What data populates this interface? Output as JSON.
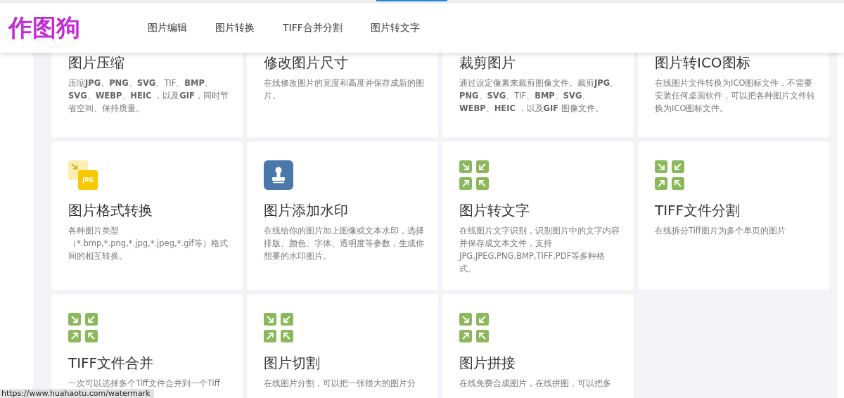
{
  "header": {
    "logo": "作图狗",
    "nav": [
      {
        "label": "图片编辑"
      },
      {
        "label": "图片转换"
      },
      {
        "label": "TIFF合并分割"
      },
      {
        "label": "图片转文字"
      }
    ]
  },
  "tools": [
    {
      "title": "图片压缩",
      "formatted": true,
      "description": "压缩**JPG**、**PNG**、**SVG**、TIF、**BMP**、**SVG**、**WEBP**、**HEIC** ，以及**GIF**，同时节省空间、保持质量。"
    },
    {
      "title": "修改图片尺寸",
      "description": "在线修改图片的宽度和高度并保存成新的图片。"
    },
    {
      "title": "裁剪图片",
      "formatted": true,
      "description": "通过设定像素来裁剪图像文件。裁剪**JPG**、**PNG**、**SVG**、TIF、**BMP**、**SVG**、**WEBP**、**HEIC** ，以及**GIF** 图像文件。"
    },
    {
      "title": "图片转ICO图标",
      "description": "在线图片文件转换为ICO图标文件，不需要安装任何桌面软件，可以把各种图片文件转换为ICO图标文件。"
    },
    {
      "icon": {
        "kind": "format",
        "text": "JPG"
      },
      "title": "图片格式转换",
      "description": "各种图片类型（*.bmp,*.png,*.jpg,*.jpeg,*.gif等）格式间的相互转换。"
    },
    {
      "icon": {
        "kind": "stamp"
      },
      "title": "图片添加水印",
      "description": "在线给你的图片加上图像或文本水印，选择排版、颜色、字体、透明度等参数，生成你想要的水印图片。"
    },
    {
      "icon": {
        "kind": "arrows"
      },
      "title": "图片转文字",
      "description": "在线图片文字识别，识别图片中的文字内容并保存成文本文件，支持JPG,JPEG,PNG,BMP,TIFF,PDF等多种格式。"
    },
    {
      "icon": {
        "kind": "arrows"
      },
      "title": "TIFF文件分割",
      "description": "在线拆分Tiff图片为多个单页的图片"
    },
    {
      "icon": {
        "kind": "arrows"
      },
      "title": "TIFF文件合并",
      "description": "一次可以选择多个Tiff文件合并到一个Tiff"
    },
    {
      "icon": {
        "kind": "arrows"
      },
      "title": "图片切割",
      "description": "在线图片分割，可以把一张很大的图片分"
    },
    {
      "icon": {
        "kind": "arrows"
      },
      "title": "图片拼接",
      "description": "在线免费合成图片，在线拼图，可以把多"
    }
  ],
  "status_url": "https://www.huahaotu.com/watermark"
}
